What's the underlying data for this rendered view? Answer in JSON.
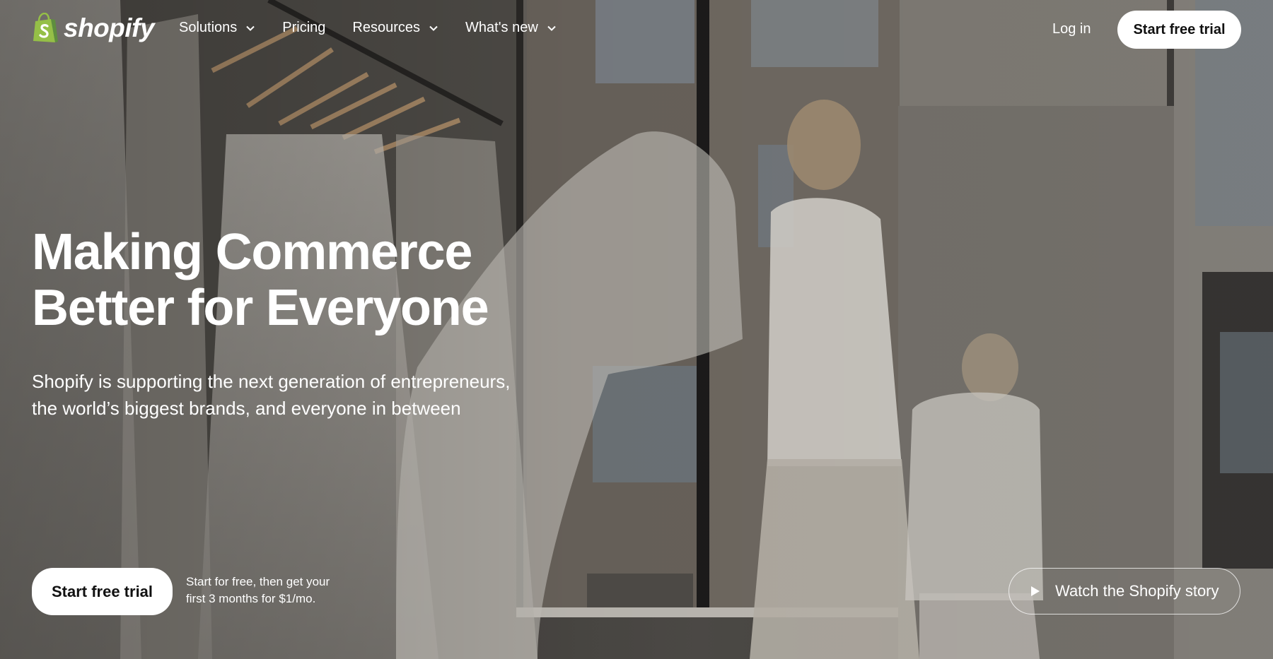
{
  "brand": {
    "name": "shopify",
    "logo_icon": "shopping-bag-icon",
    "colors": {
      "bag_green": "#95BF47",
      "bag_dark": "#5E8E3E",
      "button_bg": "#FFFFFF",
      "button_text": "#111111"
    }
  },
  "nav": {
    "items": [
      {
        "label": "Solutions",
        "has_dropdown": true,
        "icon": "chevron-down-icon"
      },
      {
        "label": "Pricing",
        "has_dropdown": false
      },
      {
        "label": "Resources",
        "has_dropdown": true,
        "icon": "chevron-down-icon"
      },
      {
        "label": "What's new",
        "has_dropdown": true,
        "icon": "chevron-down-icon"
      }
    ],
    "login_label": "Log in",
    "cta_label": "Start free trial"
  },
  "hero": {
    "headline_line1": "Making Commerce",
    "headline_line2": "Better for Everyone",
    "subheading_line1": "Shopify is supporting the next generation of entrepreneurs,",
    "subheading_line2": "the world’s biggest brands, and everyone in between",
    "cta_label": "Start free trial",
    "cta_note_line1": "Start for free, then get your",
    "cta_note_line2": "first 3 months for $1/mo.",
    "video_button_label": "Watch the Shopify story",
    "video_icon": "play-icon"
  }
}
